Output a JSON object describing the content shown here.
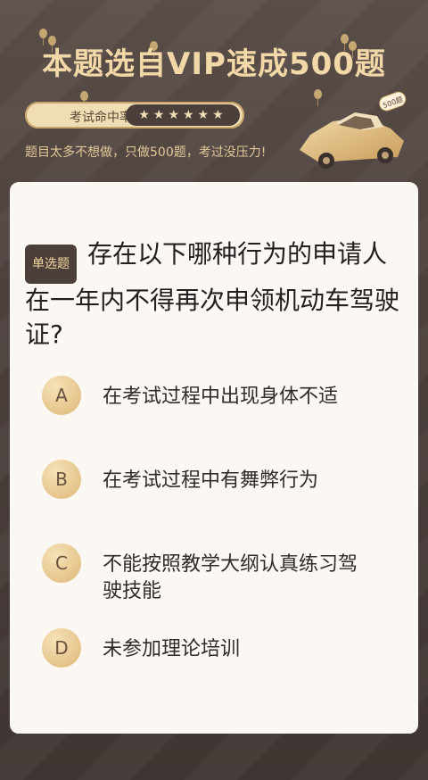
{
  "header": {
    "title": "本题选自VIP速成500题",
    "pill_label": "考试命中率",
    "stars": "★★★★★★",
    "subline": "题目太多不想做，只做500题，考过没压力!",
    "car_tag": "500题"
  },
  "question": {
    "badge": "单选题",
    "text": "存在以下哪种行为的申请人在一年内不得再次申领机动车驾驶证?"
  },
  "options": [
    {
      "letter": "A",
      "text": "在考试过程中出现身体不适"
    },
    {
      "letter": "B",
      "text": "在考试过程中有舞弊行为"
    },
    {
      "letter": "C",
      "text": "不能按照教学大纲认真练习驾驶技能"
    },
    {
      "letter": "D",
      "text": "未参加理论培训"
    }
  ],
  "colors": {
    "background": "#4a3f3b",
    "gold": "#f2d8a6",
    "card": "#fbf8f3"
  }
}
